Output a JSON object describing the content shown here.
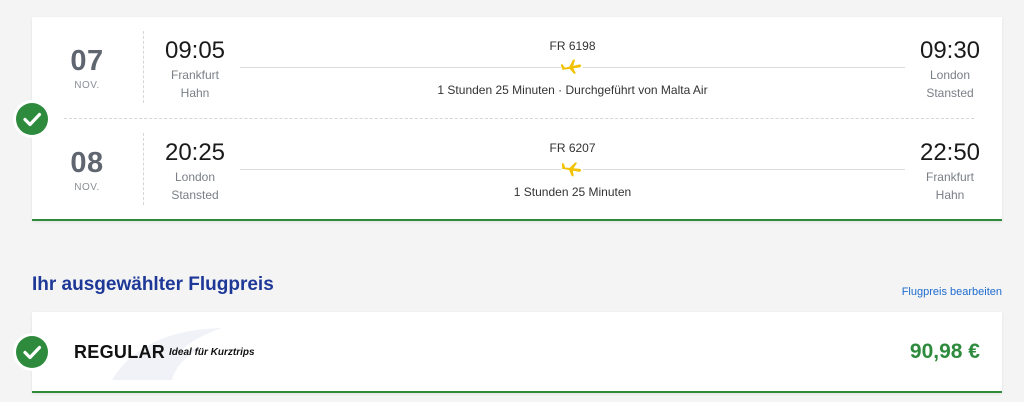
{
  "flights": [
    {
      "day": "07",
      "month": "NOV.",
      "departure_time": "09:05",
      "departure_city_line1": "Frankfurt",
      "departure_city_line2": "Hahn",
      "flight_number": "FR 6198",
      "duration": "1 Stunden 25 Minuten · Durchgeführt von Malta Air",
      "arrival_time": "09:30",
      "arrival_city_line1": "London",
      "arrival_city_line2": "Stansted",
      "plane_icon": "airplane-takeoff-icon"
    },
    {
      "day": "08",
      "month": "NOV.",
      "departure_time": "20:25",
      "departure_city_line1": "London",
      "departure_city_line2": "Stansted",
      "flight_number": "FR 6207",
      "duration": "1 Stunden 25 Minuten",
      "arrival_time": "22:50",
      "arrival_city_line1": "Frankfurt",
      "arrival_city_line2": "Hahn",
      "plane_icon": "airplane-landing-icon"
    }
  ],
  "fare_section": {
    "title": "Ihr ausgewählter Flugpreis",
    "edit_link": "Flugpreis bearbeiten"
  },
  "fare": {
    "name": "REGULAR",
    "tagline": "Ideal für Kurztrips",
    "price": "90,98 €"
  },
  "colors": {
    "accent_green": "#2e8b3d",
    "title_blue": "#1e3898",
    "link_blue": "#1e6ccf",
    "plane_yellow": "#f2c200"
  },
  "icons": {
    "selected_check": "checkmark-icon"
  }
}
